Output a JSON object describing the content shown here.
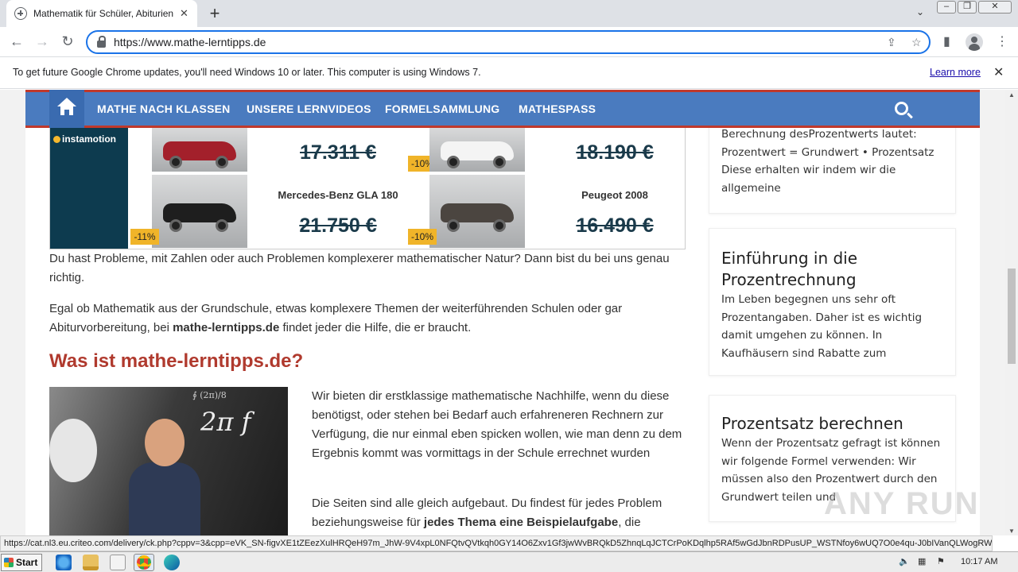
{
  "browser": {
    "tab_title": "Mathematik für Schüler, Abiturienten",
    "new_tab": "+",
    "url": "https://www.mathe-lerntipps.de",
    "tab_search_icon": "chevron-down-icon"
  },
  "infobar": {
    "message": "To get future Google Chrome updates, you'll need Windows 10 or later. This computer is using Windows 7.",
    "learn_more": "Learn more"
  },
  "site": {
    "menu": [
      "MATHE NACH KLASSEN",
      "UNSERE LERNVIDEOS",
      "FORMELSAMMLUNG",
      "MATHESPASS"
    ]
  },
  "ad": {
    "brand": "instamotion",
    "cars": [
      {
        "name": "",
        "price": "17.311 €",
        "discount": "",
        "color": "#a3202b"
      },
      {
        "name": "",
        "price": "18.190 €",
        "discount": "-10%",
        "color": "#f4f4f4"
      },
      {
        "name": "Mercedes-Benz GLA 180",
        "price": "21.750 €",
        "discount": "-11%",
        "color": "#1e1e1e"
      },
      {
        "name": "Peugeot 2008",
        "price": "16.490 €",
        "discount": "-10%",
        "color": "#4b4540"
      }
    ]
  },
  "article": {
    "intro1": "Du hast Probleme, mit Zahlen oder auch Problemen komplexerer mathematischer Natur? Dann bist du bei uns genau richtig.",
    "intro2_pre": "Egal ob Mathematik aus der Grundschule, etwas komplexere Themen der weiterführenden Schulen oder gar Abiturvorbereitung, bei ",
    "intro2_bold": "mathe-lerntipps.de",
    "intro2_post": " findet jeder die Hilfe, die er braucht.",
    "heading": "Was ist mathe-lerntipps.de?",
    "para1": "Wir bieten dir erstklassige mathematische Nachhilfe, wenn du diese benötigst, oder stehen bei Bedarf auch erfahreneren Rechnern zur Verfügung, die nur einmal eben spicken wollen, wie man denn zu dem Ergebnis kommt was vormittags in der Schule errechnet wurden",
    "para2_pre": "Die Seiten sind alle gleich aufgebaut. Du findest für jedes Problem beziehungsweise für ",
    "para2_bold": "jedes Thema eine Beispielaufgabe",
    "para2_post": ", die",
    "photo_formula": "2π f",
    "photo_formula2": "∮ (2π)/8"
  },
  "sidebar": [
    {
      "title": "",
      "text": "Berechnung desProzentwerts lautet: Prozentwert = Grundwert • Prozentsatz Diese erhalten wir indem wir die allgemeine"
    },
    {
      "title": "Einführung in die Prozentrechnung",
      "text": "Im Leben begegnen uns sehr oft Prozentangaben. Daher ist es wichtig damit umgehen zu können. In Kaufhäusern sind Rabatte zum"
    },
    {
      "title": "Prozentsatz berechnen",
      "text": "Wenn der Prozentsatz gefragt ist können wir folgende Formel verwenden: Wir müssen also den Prozentwert durch den Grundwert teilen und"
    }
  ],
  "status_url": "https://cat.nl3.eu.criteo.com/delivery/ck.php?cppv=3&cpp=eVK_SN-figvXE1tZEezXulHRQeH97m_JhW-9V4xpL0NFQtvQVtkqh0GY14O6Zxv1Gf3jwWvBRQkD5ZhnqLqJCTCrPoKDqlhp5RAf5wGdJbnRDPusUP_WSTNfoy6wUQ7O0e4qu-J0bIVanQLWogRWK9dBF...",
  "watermark": "ANY RUN",
  "taskbar": {
    "start": "Start",
    "clock": "10:17 AM"
  }
}
